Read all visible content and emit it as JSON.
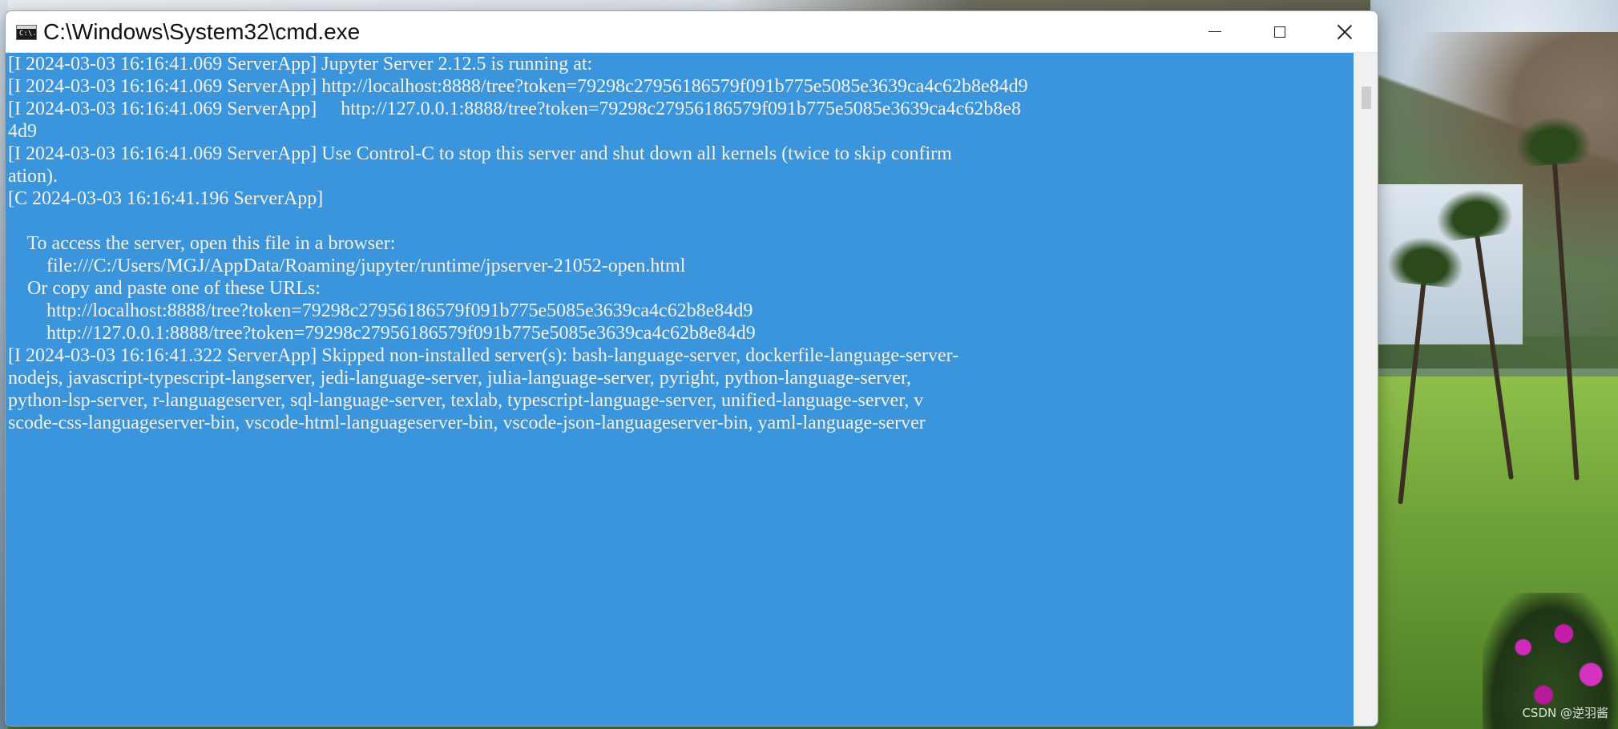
{
  "window": {
    "title": "C:\\Windows\\System32\\cmd.exe",
    "icon": "console-icon",
    "icon_text": "C:\\."
  },
  "controls": {
    "minimize": "minimize-icon",
    "maximize": "maximize-icon",
    "close": "close-icon"
  },
  "colors": {
    "console_bg": "#3a95dc",
    "console_text": "#f2f2e8"
  },
  "console_lines": [
    "[I 2024-03-03 16:16:41.069 ServerApp] Jupyter Server 2.12.5 is running at:",
    "[I 2024-03-03 16:16:41.069 ServerApp] http://localhost:8888/tree?token=79298c27956186579f091b775e5085e3639ca4c62b8e84d9",
    "[I 2024-03-03 16:16:41.069 ServerApp]     http://127.0.0.1:8888/tree?token=79298c27956186579f091b775e5085e3639ca4c62b8e8",
    "4d9",
    "[I 2024-03-03 16:16:41.069 ServerApp] Use Control-C to stop this server and shut down all kernels (twice to skip confirm",
    "ation).",
    "[C 2024-03-03 16:16:41.196 ServerApp]",
    "",
    "    To access the server, open this file in a browser:",
    "        file:///C:/Users/MGJ/AppData/Roaming/jupyter/runtime/jpserver-21052-open.html",
    "    Or copy and paste one of these URLs:",
    "        http://localhost:8888/tree?token=79298c27956186579f091b775e5085e3639ca4c62b8e84d9",
    "        http://127.0.0.1:8888/tree?token=79298c27956186579f091b775e5085e3639ca4c62b8e84d9",
    "[I 2024-03-03 16:16:41.322 ServerApp] Skipped non-installed server(s): bash-language-server, dockerfile-language-server-",
    "nodejs, javascript-typescript-langserver, jedi-language-server, julia-language-server, pyright, python-language-server,",
    "python-lsp-server, r-languageserver, sql-language-server, texlab, typescript-language-server, unified-language-server, v",
    "scode-css-languageserver-bin, vscode-html-languageserver-bin, vscode-json-languageserver-bin, yaml-language-server"
  ],
  "desktop": {
    "watermark": "CSDN @逆羽酱"
  }
}
